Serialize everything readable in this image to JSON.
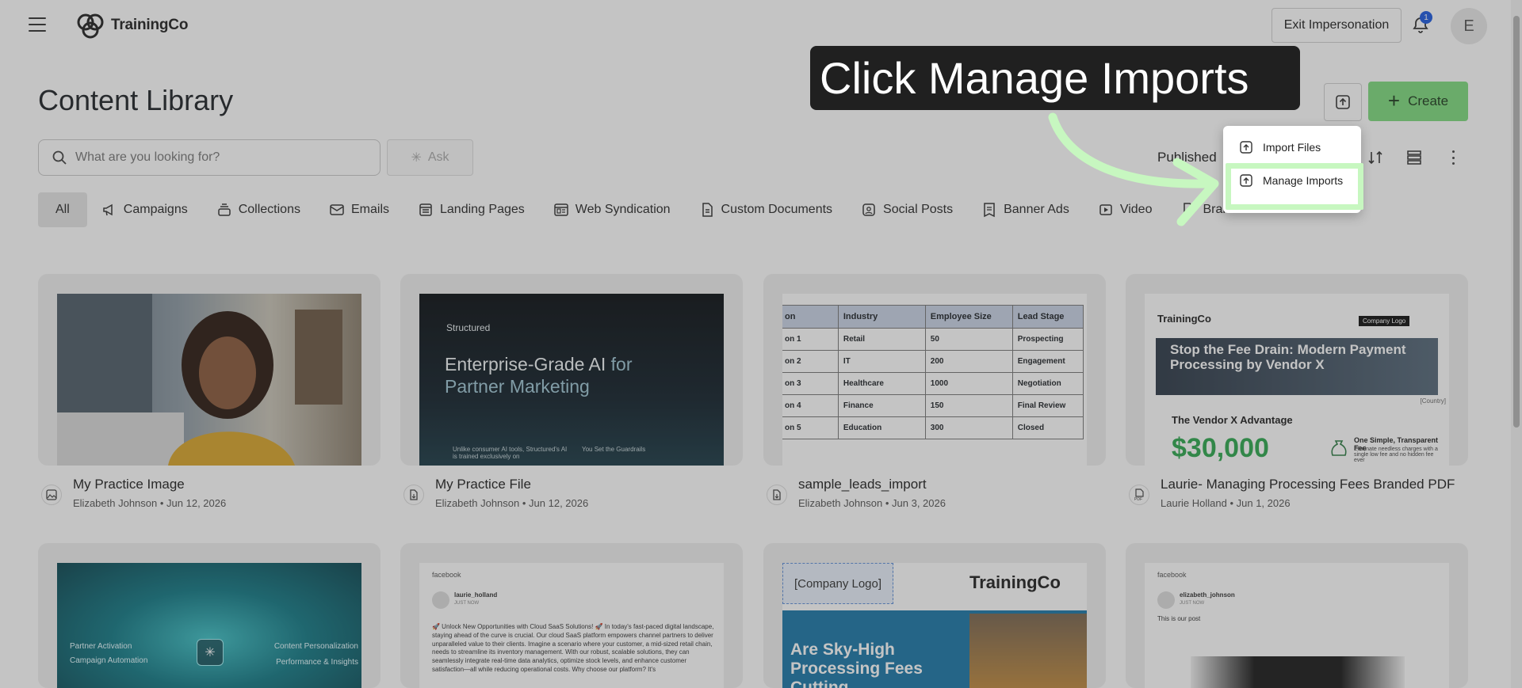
{
  "app": {
    "brand": "TrainingCo"
  },
  "header": {
    "exit_label": "Exit Impersonation",
    "notification_count": "1",
    "avatar_initial": "E"
  },
  "page": {
    "title": "Content Library",
    "create_label": "Create",
    "search_placeholder": "What are you looking for?",
    "ask_label": "Ask",
    "status_filter": "Published"
  },
  "tabs": [
    {
      "label": "All",
      "icon": "all"
    },
    {
      "label": "Campaigns",
      "icon": "megaphone-icon"
    },
    {
      "label": "Collections",
      "icon": "stack-icon"
    },
    {
      "label": "Emails",
      "icon": "mail-icon"
    },
    {
      "label": "Landing Pages",
      "icon": "page-icon"
    },
    {
      "label": "Web Syndication",
      "icon": "web-icon"
    },
    {
      "label": "Custom Documents",
      "icon": "document-icon"
    },
    {
      "label": "Social Posts",
      "icon": "social-icon"
    },
    {
      "label": "Banner Ads",
      "icon": "banner-icon"
    },
    {
      "label": "Video",
      "icon": "video-icon"
    },
    {
      "label": "Branded PDF",
      "icon": "pdf-icon"
    }
  ],
  "popup": {
    "import_files": "Import Files",
    "manage_imports": "Manage Imports"
  },
  "callout": {
    "text": "Click Manage Imports"
  },
  "cards": [
    {
      "title": "My Practice Image",
      "author": "Elizabeth Johnson",
      "date": "Jun 12, 2026",
      "type_icon": "image-icon"
    },
    {
      "title": "My Practice File",
      "author": "Elizabeth Johnson",
      "date": "Jun 12, 2026",
      "type_icon": "file-icon",
      "thumb": {
        "brand": "Structured",
        "headline_1": "Enterprise-Grade AI",
        "headline_1b": "for",
        "headline_2": "Partner Marketing",
        "foot_left": "Unlike consumer AI tools, Structured's AI is trained exclusively on",
        "foot_right": "You Set the Guardrails"
      }
    },
    {
      "title": "sample_leads_import",
      "author": "Elizabeth Johnson",
      "date": "Jun 3, 2026",
      "type_icon": "file-icon",
      "thumb": {
        "headers": [
          "on",
          "Industry",
          "Employee Size",
          "Lead Stage"
        ],
        "rows": [
          [
            "on 1",
            "Retail",
            "50",
            "Prospecting"
          ],
          [
            "on 2",
            "IT",
            "200",
            "Engagement"
          ],
          [
            "on 3",
            "Healthcare",
            "1000",
            "Negotiation"
          ],
          [
            "on 4",
            "Finance",
            "150",
            "Final Review"
          ],
          [
            "on 5",
            "Education",
            "300",
            "Closed"
          ]
        ]
      }
    },
    {
      "title": "Laurie- Managing Processing Fees Branded PDF",
      "author": "Laurie Holland",
      "date": "Jun 1, 2026",
      "type_icon": "pdf-icon",
      "thumb": {
        "brand": "TrainingCo",
        "logo_box": "Company Logo",
        "banner": "Stop the Fee Drain: Modern Payment Processing by Vendor X",
        "country": "[Country]",
        "advantage": "The Vendor X Advantage",
        "price": "$30,000",
        "fee_title": "One Simple, Transparent Fee",
        "fee_text": "Eliminate needless charges with a single low fee and no hidden fee ever"
      }
    }
  ],
  "row2": [
    {
      "left_a": "Partner Activation",
      "left_b": "Campaign Automation",
      "right_a": "Content Personalization",
      "right_b": "Performance & Insights"
    },
    {
      "platform": "facebook",
      "user": "laurie_holland",
      "when": "JUST NOW",
      "text": "🚀 Unlock New Opportunities with Cloud SaaS Solutions! 🚀 In today's fast-paced digital landscape, staying ahead of the curve is crucial. Our cloud SaaS platform empowers channel partners to deliver unparalleled value to their clients. Imagine a scenario where your customer, a mid-sized retail chain, needs to streamline its inventory management. With our robust, scalable solutions, they can seamlessly integrate real-time data analytics, optimize stock levels, and enhance customer satisfaction—all while reducing operational costs. Why choose our platform? It's"
    },
    {
      "logo_box": "[Company Logo]",
      "brand": "TrainingCo",
      "headline": "Are Sky-High Processing Fees Cutting"
    },
    {
      "platform": "facebook",
      "user": "elizabeth_johnson",
      "when": "JUST NOW",
      "text": "This is our post"
    }
  ],
  "colors": {
    "accent_green": "#7fdc7f",
    "highlight": "#c7f7c0",
    "badge_blue": "#1d5be0"
  }
}
